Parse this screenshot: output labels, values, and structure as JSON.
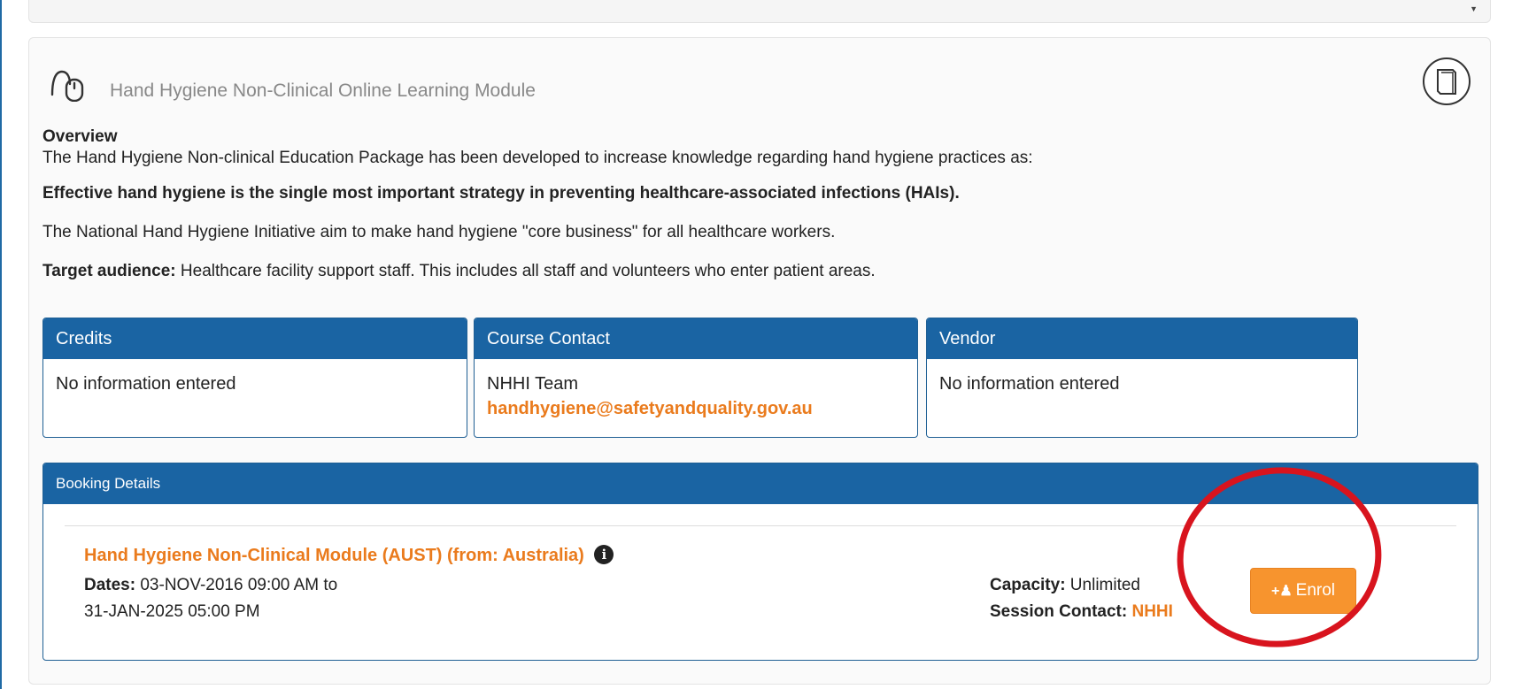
{
  "course": {
    "title": "Hand Hygiene Non-Clinical Online Learning Module",
    "overview_heading": "Overview",
    "p1": "The Hand Hygiene Non-clinical Education Package has been developed to increase knowledge regarding hand hygiene practices as:",
    "p2": "Effective hand hygiene is the single most important strategy in preventing healthcare-associated infections (HAIs).",
    "p3": "The National Hand Hygiene Initiative aim to make hand hygiene \"core business\" for all healthcare workers.",
    "target_label": "Target audience:",
    "target_text": " Healthcare facility support staff. This includes all staff and volunteers who enter patient areas."
  },
  "boxes": {
    "credits": {
      "title": "Credits",
      "body": "No information entered"
    },
    "contact": {
      "title": "Course Contact",
      "name": "NHHI Team",
      "email": "handhygiene@safetyandquality.gov.au"
    },
    "vendor": {
      "title": "Vendor",
      "body": "No information entered"
    }
  },
  "booking": {
    "heading": "Booking Details",
    "session_title": "Hand Hygiene Non-Clinical Module (AUST) (from: Australia)",
    "dates_label": "Dates:",
    "dates_line1": " 03-NOV-2016 09:00 AM to",
    "dates_line2": "31-JAN-2025 05:00 PM",
    "capacity_label": "Capacity:",
    "capacity_value": " Unlimited",
    "session_contact_label": "Session Contact:",
    "session_contact_value": "NHHI",
    "enrol_label": "Enrol"
  },
  "icons": {
    "course_type": "mouse-icon",
    "module_book": "book-icon",
    "session_info": "info-icon",
    "enrol": "add-user-icon"
  },
  "colors": {
    "primary": "#1a64a3",
    "accent_orange": "#ea7b1d",
    "button_orange": "#f7942e",
    "annotation_red": "#d8141e"
  }
}
